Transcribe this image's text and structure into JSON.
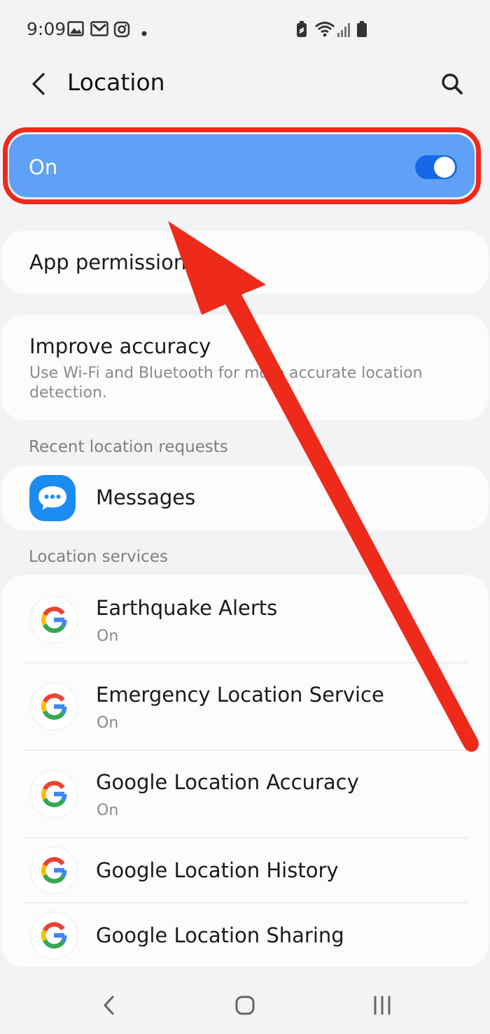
{
  "status_bar": {
    "time": "9:09",
    "left_icons": [
      "gallery-icon",
      "gmail-icon",
      "instagram-icon",
      "notification-dot-icon"
    ],
    "right_icons": [
      "battery-saver-icon",
      "wifi-icon",
      "signal-icon",
      "battery-icon"
    ]
  },
  "header": {
    "title": "Location",
    "back_icon": "chevron-left-icon",
    "search_icon": "search-icon"
  },
  "master_switch": {
    "label": "On",
    "enabled": true
  },
  "app_permissions": {
    "label": "App permissions"
  },
  "improve_accuracy": {
    "title": "Improve accuracy",
    "subtitle": "Use Wi-Fi and Bluetooth for more accurate location detection."
  },
  "recent_requests": {
    "section_title": "Recent location requests",
    "items": [
      {
        "label": "Messages",
        "icon": "messages-icon"
      }
    ]
  },
  "location_services": {
    "section_title": "Location services",
    "items": [
      {
        "title": "Earthquake Alerts",
        "status": "On",
        "icon": "google-icon"
      },
      {
        "title": "Emergency Location Service",
        "status": "On",
        "icon": "google-icon"
      },
      {
        "title": "Google Location Accuracy",
        "status": "On",
        "icon": "google-icon"
      },
      {
        "title": "Google Location History",
        "icon": "google-icon"
      },
      {
        "title": "Google Location Sharing",
        "icon": "google-icon"
      }
    ]
  },
  "nav_bar": {
    "icons": [
      "back-nav-icon",
      "home-nav-icon",
      "recents-nav-icon"
    ]
  },
  "colors": {
    "background": "#f3f3f5",
    "master_switch_bg": "#5fa1f6",
    "toggle_track": "#1768e6",
    "annotation_red": "#ee2a1b",
    "messages_blue": "#1a8cf2"
  }
}
